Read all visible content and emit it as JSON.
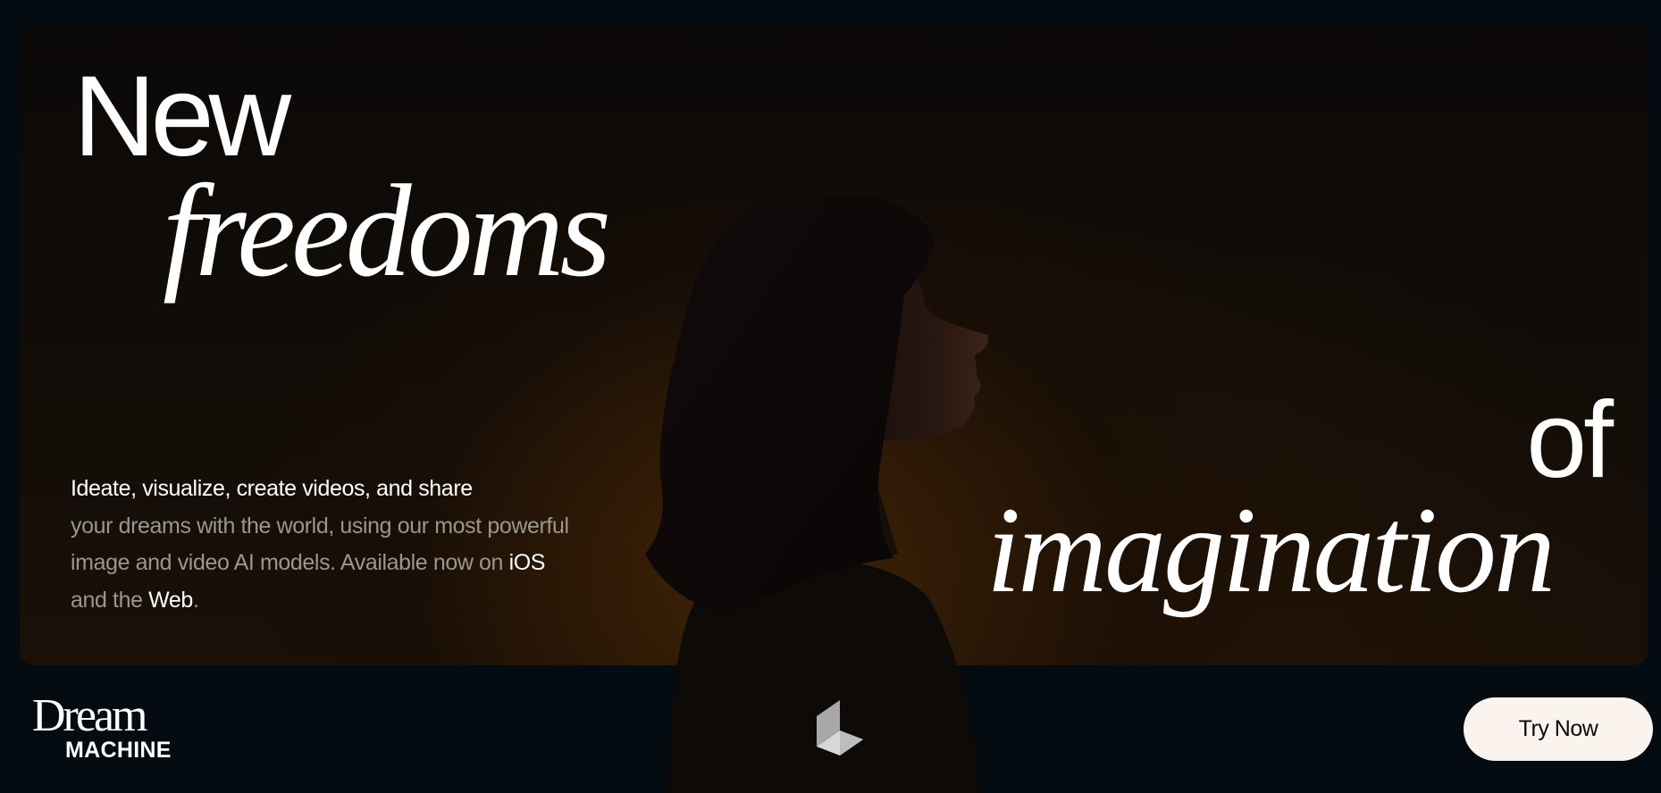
{
  "hero": {
    "headline": {
      "word_1": "New",
      "word_2": "freedoms",
      "word_3": "of",
      "word_4": "imagination"
    },
    "description": {
      "line_1": "Ideate, visualize, create videos, and share",
      "text_2": "your dreams with the world, using our most powerful image and video AI models. Available now on ",
      "link_ios": "iOS",
      "text_3": " and the ",
      "link_web": "Web",
      "text_4": "."
    }
  },
  "footer": {
    "logo": {
      "line_1": "Dream",
      "line_2": "MACHINE"
    },
    "cta_label": "Try Now"
  },
  "colors": {
    "background": "#050c11",
    "accent_warm": "#462606",
    "button_bg": "#fbf3ee",
    "text_primary": "#ffffff",
    "text_muted": "#9a9690"
  },
  "icons": {
    "center_mark": "luma-logo-icon"
  }
}
